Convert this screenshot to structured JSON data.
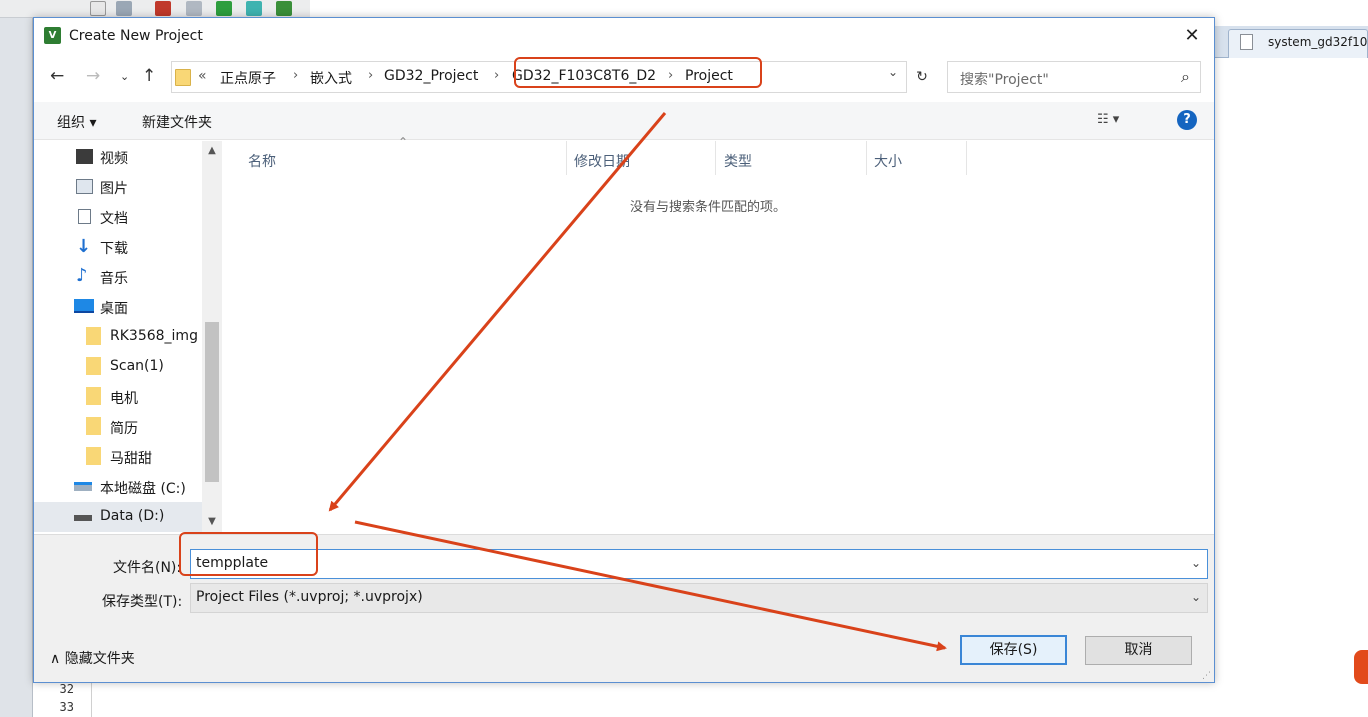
{
  "ide": {
    "tab_label": "system_gd32f10",
    "line_numbers": [
      "32",
      "33"
    ]
  },
  "dialog": {
    "title": "Create New Project",
    "close_glyph": "✕",
    "app_icon_text": "V"
  },
  "address": {
    "overflow": "«",
    "crumbs": [
      "正点原子",
      "嵌入式",
      "GD32_Project",
      "GD32_F103C8T6_D2",
      "Project"
    ],
    "separator": "›",
    "dropdown_glyph": "⌄",
    "refresh_glyph": "↻"
  },
  "search": {
    "placeholder": "搜索\"Project\"",
    "icon": "search-icon"
  },
  "toolbar": {
    "organize_label": "组织 ▾",
    "new_folder_label": "新建文件夹",
    "view_label": "☷ ▾",
    "help_label": "?"
  },
  "nav": {
    "items": [
      {
        "label": "视频",
        "icon": "video-icon"
      },
      {
        "label": "图片",
        "icon": "picture-icon"
      },
      {
        "label": "文档",
        "icon": "document-icon"
      },
      {
        "label": "下载",
        "icon": "download-icon"
      },
      {
        "label": "音乐",
        "icon": "music-icon"
      },
      {
        "label": "桌面",
        "icon": "desktop-icon"
      },
      {
        "label": "RK3568_img",
        "icon": "folder-icon"
      },
      {
        "label": "Scan(1)",
        "icon": "folder-icon"
      },
      {
        "label": "电机",
        "icon": "folder-icon"
      },
      {
        "label": "简历",
        "icon": "folder-icon"
      },
      {
        "label": "马甜甜",
        "icon": "folder-icon"
      },
      {
        "label": "本地磁盘 (C:)",
        "icon": "drive-icon"
      },
      {
        "label": "Data (D:)",
        "icon": "drive-icon"
      }
    ]
  },
  "filelist": {
    "columns": [
      "名称",
      "修改日期",
      "类型",
      "大小"
    ],
    "empty_message": "没有与搜索条件匹配的项。"
  },
  "form": {
    "filename_label": "文件名(N):",
    "filename_value": "tempplate",
    "filetype_label": "保存类型(T):",
    "filetype_value": "Project Files (*.uvproj; *.uvprojx)",
    "hide_folders_label": "∧  隐藏文件夹",
    "save_label": "保存(S)",
    "cancel_label": "取消"
  },
  "colors": {
    "annotation": "#d9421a",
    "accent": "#1565c0",
    "folder": "#f9d776"
  }
}
